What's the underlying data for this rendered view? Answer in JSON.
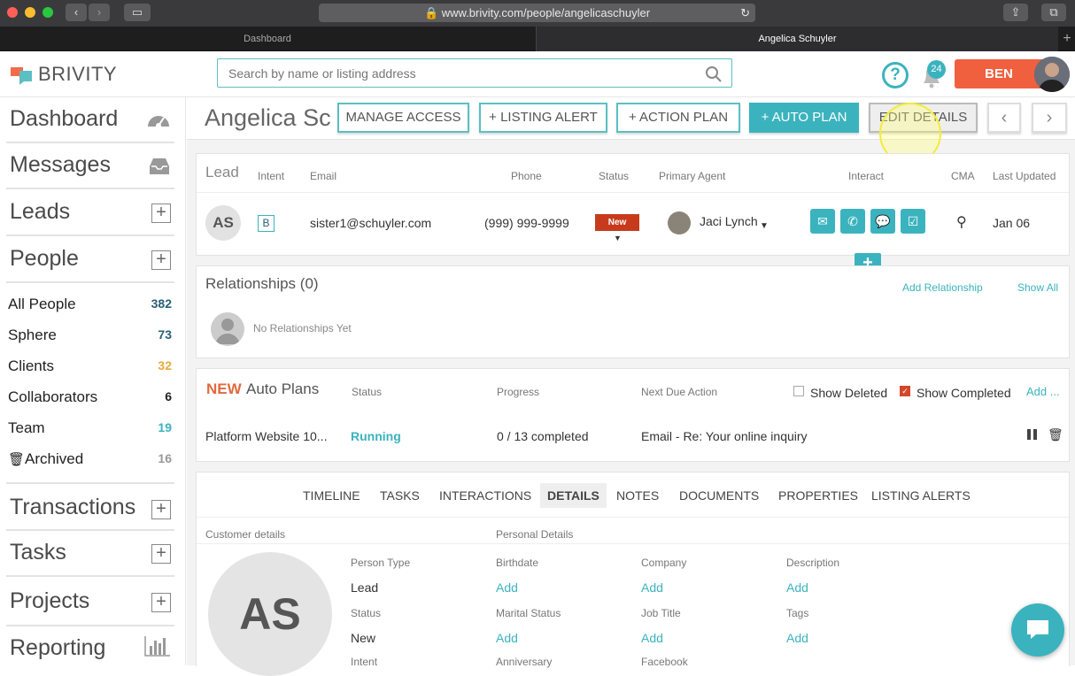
{
  "browser": {
    "url": "www.brivity.com/people/angelicaschuyler",
    "tabs": [
      "Dashboard",
      "Angelica Schuyler"
    ]
  },
  "header": {
    "logo": "BRIVITY",
    "search_placeholder": "Search by name or listing address",
    "notification_count": "24",
    "user_button": "BEN"
  },
  "sidebar": {
    "dashboard": "Dashboard",
    "messages": "Messages",
    "leads": "Leads",
    "people": "People",
    "people_items": [
      {
        "label": "All People",
        "count": "382",
        "color": "#2a5f7a"
      },
      {
        "label": "Sphere",
        "count": "73",
        "color": "#2a5f7a"
      },
      {
        "label": "Clients",
        "count": "32",
        "color": "#e8a93c"
      },
      {
        "label": "Collaborators",
        "count": "6",
        "color": "#222222"
      },
      {
        "label": "Team",
        "count": "19",
        "color": "#3bb3be"
      },
      {
        "label": "Archived",
        "count": "16",
        "color": "#999999"
      }
    ],
    "transactions": "Transactions",
    "tasks": "Tasks",
    "projects": "Projects",
    "reporting": "Reporting"
  },
  "page": {
    "name": "Angelica Sc",
    "buttons": {
      "manage_access": "MANAGE ACCESS",
      "listing_alert": "+ LISTING ALERT",
      "action_plan": "+ ACTION PLAN",
      "auto_plan": "+ AUTO PLAN",
      "edit_details": "EDIT DETAILS"
    }
  },
  "lead_table": {
    "headers": {
      "lead": "Lead",
      "intent": "Intent",
      "email": "Email",
      "phone": "Phone",
      "status": "Status",
      "agent": "Primary Agent",
      "interact": "Interact",
      "cma": "CMA",
      "updated": "Last Updated"
    },
    "row": {
      "initials": "AS",
      "intent": "B",
      "email": "sister1@schuyler.com",
      "phone": "(999) 999-9999",
      "status": "New",
      "agent": "Jaci Lynch",
      "updated": "Jan 06"
    }
  },
  "relationships": {
    "title": "Relationships (0)",
    "add": "Add Relationship",
    "show_all": "Show All",
    "empty": "No Relationships Yet"
  },
  "auto_plans": {
    "new_label": "NEW",
    "title": "Auto Plans",
    "headers": {
      "status": "Status",
      "progress": "Progress",
      "next": "Next Due Action"
    },
    "show_deleted": "Show Deleted",
    "show_completed": "Show Completed",
    "add": "Add ...",
    "row": {
      "name": "Platform Website 10...",
      "status": "Running",
      "progress": "0 / 13 completed",
      "next": "Email - Re: Your online inquiry"
    }
  },
  "detail_tabs": [
    "TIMELINE",
    "TASKS",
    "INTERACTIONS",
    "DETAILS",
    "NOTES",
    "DOCUMENTS",
    "PROPERTIES",
    "LISTING ALERTS"
  ],
  "details": {
    "customer_details": "Customer details",
    "personal_details": "Personal Details",
    "initials": "AS",
    "person_type_label": "Person Type",
    "person_type": "Lead",
    "status_label": "Status",
    "status": "New",
    "intent_label": "Intent",
    "birthdate": "Birthdate",
    "marital": "Marital Status",
    "anniversary": "Anniversary",
    "company": "Company",
    "job_title": "Job Title",
    "facebook": "Facebook",
    "description": "Description",
    "tags": "Tags",
    "add": "Add"
  }
}
